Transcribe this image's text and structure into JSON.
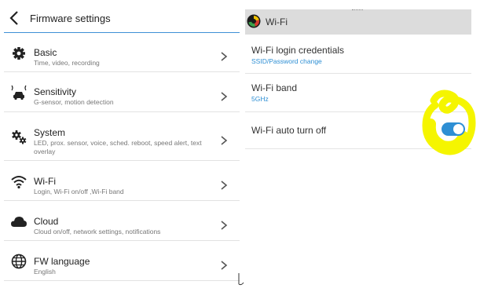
{
  "firmware": {
    "title": "Firmware settings",
    "items": [
      {
        "title": "Basic",
        "subtitle": "Time, video, recording",
        "icon": "gear-icon"
      },
      {
        "title": "Sensitivity",
        "subtitle": "G-sensor, motion detection",
        "icon": "car-sensor-icon"
      },
      {
        "title": "System",
        "subtitle": "LED, prox. sensor, voice, sched. reboot, speed alert, text overlay",
        "icon": "system-gears-icon"
      },
      {
        "title": "Wi-Fi",
        "subtitle": "Login, Wi-Fi on/off ,Wi-Fi band",
        "icon": "wifi-icon"
      },
      {
        "title": "Cloud",
        "subtitle": "Cloud on/off, network settings, notifications",
        "icon": "cloud-icon"
      },
      {
        "title": "FW language",
        "subtitle": "English",
        "icon": "globe-icon"
      }
    ]
  },
  "wifi": {
    "title": "Wi-Fi",
    "items": [
      {
        "title": "Wi-Fi login credentials",
        "subtitle": "SSID/Password change"
      },
      {
        "title": "Wi-Fi band",
        "subtitle": "5GHz"
      },
      {
        "title": "Wi-Fi auto turn off",
        "toggle_on": true
      }
    ]
  },
  "colors": {
    "accent": "#2e8fd4",
    "highlight": "#f5f500",
    "header_bar": "#dcdcdc"
  }
}
